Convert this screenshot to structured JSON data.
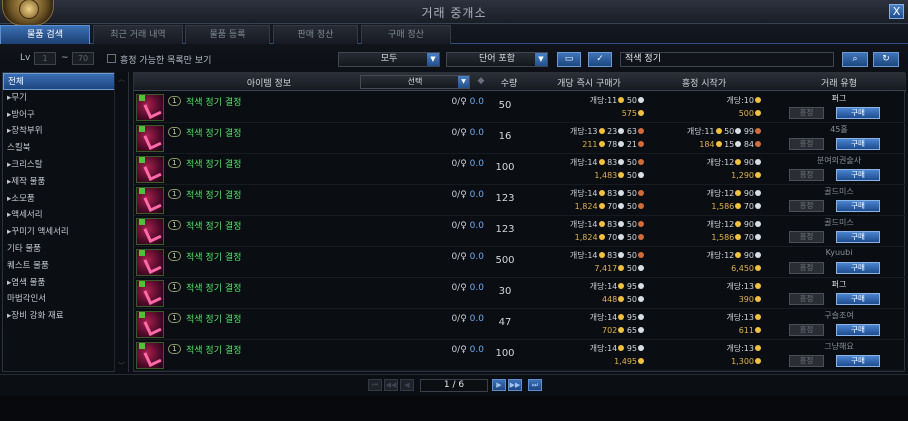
{
  "window": {
    "title": "거래 중개소",
    "close_label": "X"
  },
  "tabs": [
    "물품 검색",
    "최근 거래 내역",
    "물품 등록",
    "판매 정산",
    "구매 정산"
  ],
  "filter": {
    "lv_label": "Lv",
    "lv_min": "1",
    "lv_sep": "~",
    "lv_max": "70",
    "bid_only_label": "흥정 가능한 목록만 보기",
    "category_select": "모두",
    "match_select": "단어 포함",
    "search_value": "적색 정기",
    "search_icon": "magnifier-icon",
    "reset_icon": "refresh-icon"
  },
  "sidebar": [
    "전체",
    "무기",
    "방어구",
    "장착부위",
    "스킬북",
    "크리스탈",
    "제작 물품",
    "소모품",
    "액세서리",
    "꾸미기 액세서리",
    "기타 물품",
    "퀘스트 물품",
    "염색 물품",
    "마법각인서",
    "장비 강화 재료"
  ],
  "sidebar_prefix": [
    "",
    "▸",
    "▸",
    "▸",
    "",
    "▸",
    "▸",
    "▸",
    "▸",
    "▸",
    "",
    "",
    "▸",
    "",
    "▸"
  ],
  "columns": {
    "item_info": "아이템 정보",
    "filter": "선택",
    "qty": "수량",
    "instant_price": "개당 즉시 구매가",
    "bid_price": "흥정 시작가",
    "trade_type": "거래 유형"
  },
  "rows": [
    {
      "tier": "1",
      "name": "적색 정기 결정",
      "bid": "0/",
      "bid_val": "0.0",
      "qty": "50",
      "buy_unit": "개당:11",
      "buy_unit2": "50",
      "buy_unit3": "",
      "buy_total": "575",
      "buy_total2": "",
      "buy_total3": "",
      "start_unit": "개당:10",
      "start_unit2": "",
      "start_total": "500",
      "start_total2": "",
      "start_total3": "",
      "trader": "퍼그",
      "trader_bright": true
    },
    {
      "tier": "1",
      "name": "적색 정기 결정",
      "bid": "0/",
      "bid_val": "0.0",
      "qty": "16",
      "buy_unit": "개당:13",
      "buy_unit2": "23",
      "buy_unit3": "63",
      "buy_total": "211",
      "buy_total2": "78",
      "buy_total3": "21",
      "start_unit": "개당:11",
      "start_unit2": "50",
      "start_unit3": "99",
      "start_total": "184",
      "start_total2": "15",
      "start_total3": "84",
      "trader": "45홀",
      "trader_bright": false
    },
    {
      "tier": "1",
      "name": "적색 정기 결정",
      "bid": "0/",
      "bid_val": "0.0",
      "qty": "100",
      "buy_unit": "개당:14",
      "buy_unit2": "83",
      "buy_unit3": "50",
      "buy_total": "1,483",
      "buy_total2": "50",
      "buy_total3": "",
      "start_unit": "개당:12",
      "start_unit2": "90",
      "start_unit3": "",
      "start_total": "1,290",
      "start_total2": "",
      "start_total3": "",
      "trader": "분여의권술사",
      "trader_bright": false
    },
    {
      "tier": "1",
      "name": "적색 정기 결정",
      "bid": "0/",
      "bid_val": "0.0",
      "qty": "123",
      "buy_unit": "개당:14",
      "buy_unit2": "83",
      "buy_unit3": "50",
      "buy_total": "1,824",
      "buy_total2": "70",
      "buy_total3": "50",
      "start_unit": "개당:12",
      "start_unit2": "90",
      "start_unit3": "",
      "start_total": "1,586",
      "start_total2": "70",
      "start_total3": "",
      "trader": "골드미스",
      "trader_bright": false
    },
    {
      "tier": "1",
      "name": "적색 정기 결정",
      "bid": "0/",
      "bid_val": "0.0",
      "qty": "123",
      "buy_unit": "개당:14",
      "buy_unit2": "83",
      "buy_unit3": "50",
      "buy_total": "1,824",
      "buy_total2": "70",
      "buy_total3": "50",
      "start_unit": "개당:12",
      "start_unit2": "90",
      "start_unit3": "",
      "start_total": "1,586",
      "start_total2": "70",
      "start_total3": "",
      "trader": "골드미스",
      "trader_bright": false
    },
    {
      "tier": "1",
      "name": "적색 정기 결정",
      "bid": "0/",
      "bid_val": "0.0",
      "qty": "500",
      "buy_unit": "개당:14",
      "buy_unit2": "83",
      "buy_unit3": "50",
      "buy_total": "7,417",
      "buy_total2": "50",
      "buy_total3": "",
      "start_unit": "개당:12",
      "start_unit2": "90",
      "start_unit3": "",
      "start_total": "6,450",
      "start_total2": "",
      "start_total3": "",
      "trader": "Kyuubi",
      "trader_bright": false
    },
    {
      "tier": "1",
      "name": "적색 정기 결정",
      "bid": "0/",
      "bid_val": "0.0",
      "qty": "30",
      "buy_unit": "개당:14",
      "buy_unit2": "95",
      "buy_unit3": "",
      "buy_total": "448",
      "buy_total2": "50",
      "buy_total3": "",
      "start_unit": "개당:13",
      "start_unit2": "",
      "start_unit3": "",
      "start_total": "390",
      "start_total2": "",
      "start_total3": "",
      "trader": "퍼그",
      "trader_bright": true
    },
    {
      "tier": "1",
      "name": "적색 정기 결정",
      "bid": "0/",
      "bid_val": "0.0",
      "qty": "47",
      "buy_unit": "개당:14",
      "buy_unit2": "95",
      "buy_unit3": "",
      "buy_total": "702",
      "buy_total2": "65",
      "buy_total3": "",
      "start_unit": "개당:13",
      "start_unit2": "",
      "start_unit3": "",
      "start_total": "611",
      "start_total2": "",
      "start_total3": "",
      "trader": "구슬조여",
      "trader_bright": false
    },
    {
      "tier": "1",
      "name": "적색 정기 결정",
      "bid": "0/",
      "bid_val": "0.0",
      "qty": "100",
      "buy_unit": "개당:14",
      "buy_unit2": "95",
      "buy_unit3": "",
      "buy_total": "1,495",
      "buy_total2": "",
      "buy_total3": "",
      "start_unit": "개당:13",
      "start_unit2": "",
      "start_unit3": "",
      "start_total": "1,300",
      "start_total2": "",
      "start_total3": "",
      "trader": "그냥해요",
      "trader_bright": false
    }
  ],
  "row_buttons": {
    "watch": "흥정",
    "buy": "구매"
  },
  "pager": {
    "text": "1 / 6"
  }
}
